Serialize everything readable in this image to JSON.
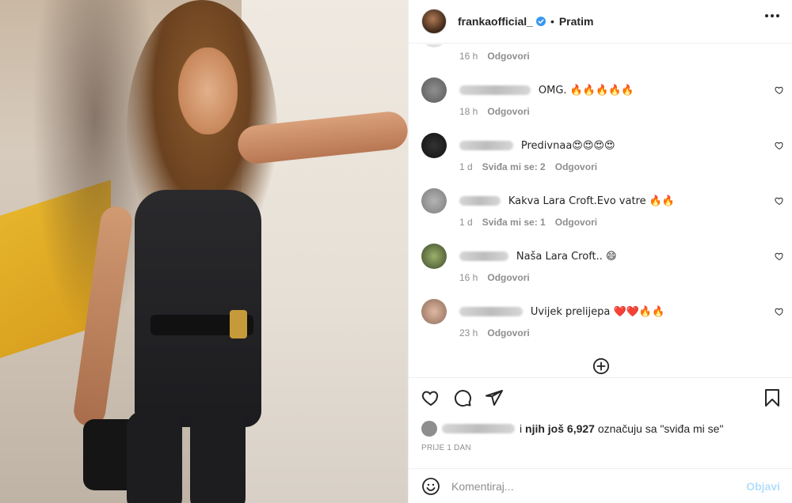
{
  "header": {
    "username": "frankaofficial_",
    "separator": "•",
    "follow_label": "Pratim"
  },
  "comments": [
    {
      "time": "16 h",
      "reply": "Odgovori",
      "text": "",
      "likes": ""
    },
    {
      "text": "OMG. 🔥🔥🔥🔥🔥",
      "time": "18 h",
      "likes": "",
      "reply": "Odgovori"
    },
    {
      "text": "Predivnaa😍😍😍😍",
      "time": "1 d",
      "likes": "Sviđa mi se: 2",
      "reply": "Odgovori"
    },
    {
      "text": "Kakva Lara Croft.Evo vatre 🔥🔥",
      "time": "1 d",
      "likes": "Sviđa mi se: 1",
      "reply": "Odgovori"
    },
    {
      "text": "Naša Lara Croft.. 😄",
      "time": "16 h",
      "likes": "",
      "reply": "Odgovori"
    },
    {
      "text": "Uvijek prelijepa ❤️❤️🔥🔥",
      "time": "23 h",
      "likes": "",
      "reply": "Odgovori"
    }
  ],
  "likes_line": {
    "prefix": "i",
    "bold": "njih još 6,927",
    "suffix": "označuju sa \"sviđa mi se\""
  },
  "time_ago": "PRIJE 1 DAN",
  "compose": {
    "placeholder": "Komentiraj...",
    "post_label": "Objavi"
  },
  "icons": {
    "like": "heart-icon",
    "comment": "comment-icon",
    "share": "paper-plane-icon",
    "save": "bookmark-icon",
    "emoji": "smiley-icon",
    "more": "ellipsis-icon",
    "verified": "verified-badge-icon",
    "load_more": "plus-circle-icon"
  },
  "colors": {
    "text": "#262626",
    "muted": "#8e8e8e",
    "verified": "#3897f0",
    "post_disabled": "#b2dffc",
    "heart_red": "#ed4956"
  }
}
